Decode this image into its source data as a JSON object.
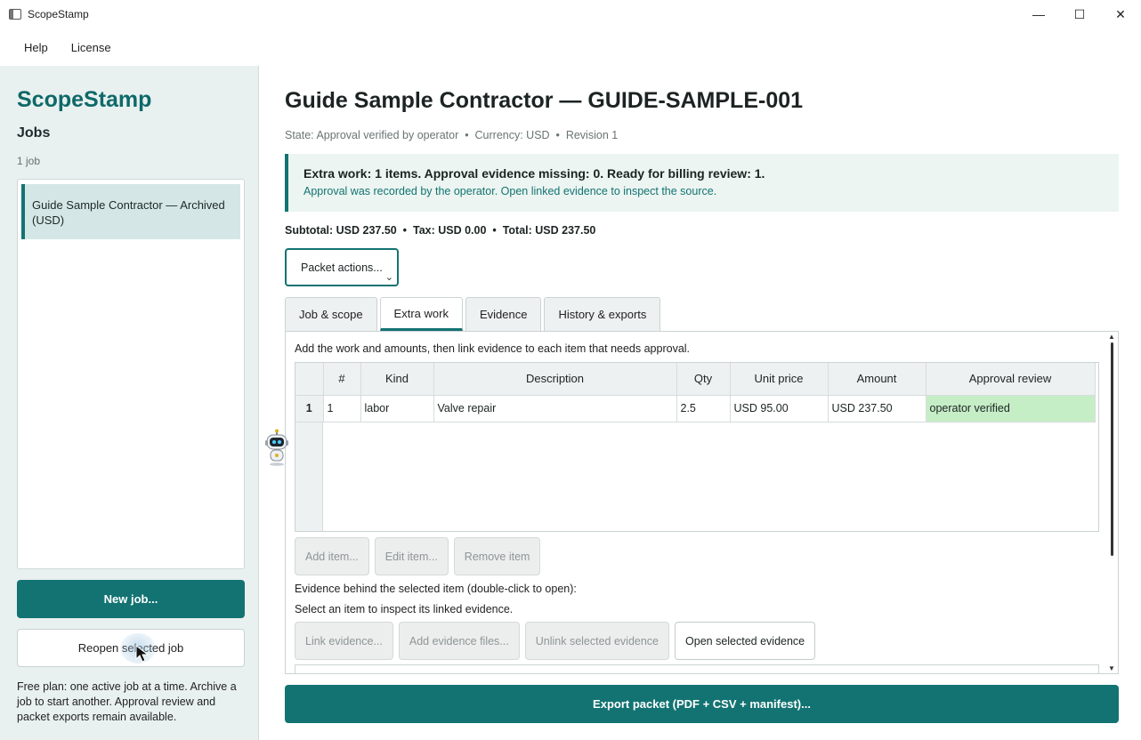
{
  "window": {
    "title": "ScopeStamp",
    "controls": {
      "minimize": "—",
      "maximize": "☐",
      "close": "✕"
    }
  },
  "menu": {
    "items": [
      "Help",
      "License"
    ]
  },
  "sidebar": {
    "brand": "ScopeStamp",
    "heading": "Jobs",
    "count": "1 job",
    "jobs": [
      {
        "label": "Guide Sample Contractor — Archived (USD)",
        "selected": true
      }
    ],
    "new_job_label": "New job...",
    "reopen_label": "Reopen selected job",
    "plan_note": "Free plan: one active job at a time. Archive a job to start another. Approval review and packet exports remain available."
  },
  "main": {
    "title": "Guide Sample Contractor — GUIDE-SAMPLE-001",
    "meta": "State: Approval verified by operator  •  Currency: USD  •  Revision 1",
    "banner": {
      "title": "Extra work: 1 items. Approval evidence missing: 0. Ready for billing review: 1.",
      "subtitle": "Approval was recorded by the operator. Open linked evidence to inspect the source."
    },
    "totals": "Subtotal: USD 237.50  •  Tax: USD 0.00  •  Total: USD 237.50",
    "packet_actions_label": "Packet actions...",
    "tabs": [
      {
        "label": "Job & scope",
        "active": false
      },
      {
        "label": "Extra work",
        "active": true
      },
      {
        "label": "Evidence",
        "active": false
      },
      {
        "label": "History & exports",
        "active": false
      }
    ],
    "extra_work": {
      "hint": "Add the work and amounts, then link evidence to each item that needs approval.",
      "columns": [
        "#",
        "Kind",
        "Description",
        "Qty",
        "Unit price",
        "Amount",
        "Approval review"
      ],
      "rows": [
        {
          "row_header": "1",
          "num": "1",
          "kind": "labor",
          "description": "Valve repair",
          "qty": "2.5",
          "unit_price": "USD 95.00",
          "amount": "USD 237.50",
          "approval": "operator verified"
        }
      ],
      "item_buttons": [
        "Add item...",
        "Edit item...",
        "Remove item"
      ],
      "evidence_label": "Evidence behind the selected item (double-click to open):",
      "evidence_hint": "Select an item to inspect its linked evidence.",
      "evidence_buttons": [
        "Link evidence...",
        "Add evidence files...",
        "Unlink selected evidence",
        "Open selected evidence"
      ]
    },
    "export_label": "Export packet (PDF + CSV + manifest)..."
  },
  "colors": {
    "accent": "#137372",
    "approved": "#c6eec6",
    "sidebar_bg": "#e9f0f0",
    "banner_bg": "#ecf5f1"
  }
}
